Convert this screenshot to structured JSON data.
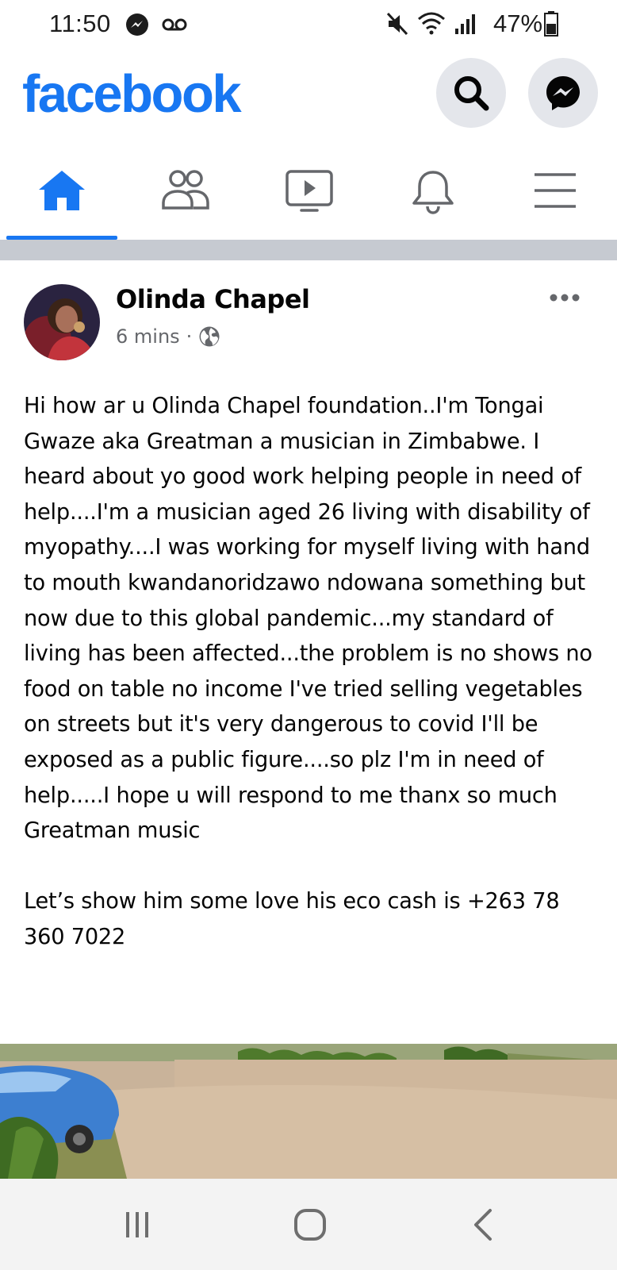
{
  "status_bar": {
    "time": "11:50",
    "battery": "47%",
    "icons": [
      "messenger-notification-icon",
      "voicemail-icon",
      "mute-icon",
      "wifi-icon",
      "signal-icon",
      "battery-icon"
    ]
  },
  "header": {
    "logo": "facebook",
    "brand_color": "#1877f2",
    "buttons": [
      "search-icon",
      "messenger-icon"
    ]
  },
  "tabs": [
    {
      "icon": "home-icon",
      "active": true
    },
    {
      "icon": "friends-icon",
      "active": false
    },
    {
      "icon": "watch-icon",
      "active": false
    },
    {
      "icon": "notifications-icon",
      "active": false
    },
    {
      "icon": "menu-icon",
      "active": false
    }
  ],
  "post": {
    "author": "Olinda Chapel",
    "time": "6 mins",
    "separator": "·",
    "privacy_icon": "globe-icon",
    "text": "Hi how ar u Olinda Chapel foundation..I'm Tongai Gwaze aka Greatman a musician in Zimbabwe. I heard about yo good work helping people in need of help....I'm a musician aged 26 living with disability of myopathy....I was working for myself living with hand to mouth kwandanoridzawo ndowana something but now due to this global pandemic...my standard of living has been affected...the problem is no shows no food on table no income I've tried selling vegetables on streets but it's very dangerous to covid I'll be exposed as a public figure....so plz I'm in need of help.....I hope u will respond to me thanx so much\nGreatman music\n\nLet’s show him some love his eco cash is +263 78 360 7022"
  },
  "navbar": [
    "recent-apps-icon",
    "home-button-icon",
    "back-icon"
  ]
}
